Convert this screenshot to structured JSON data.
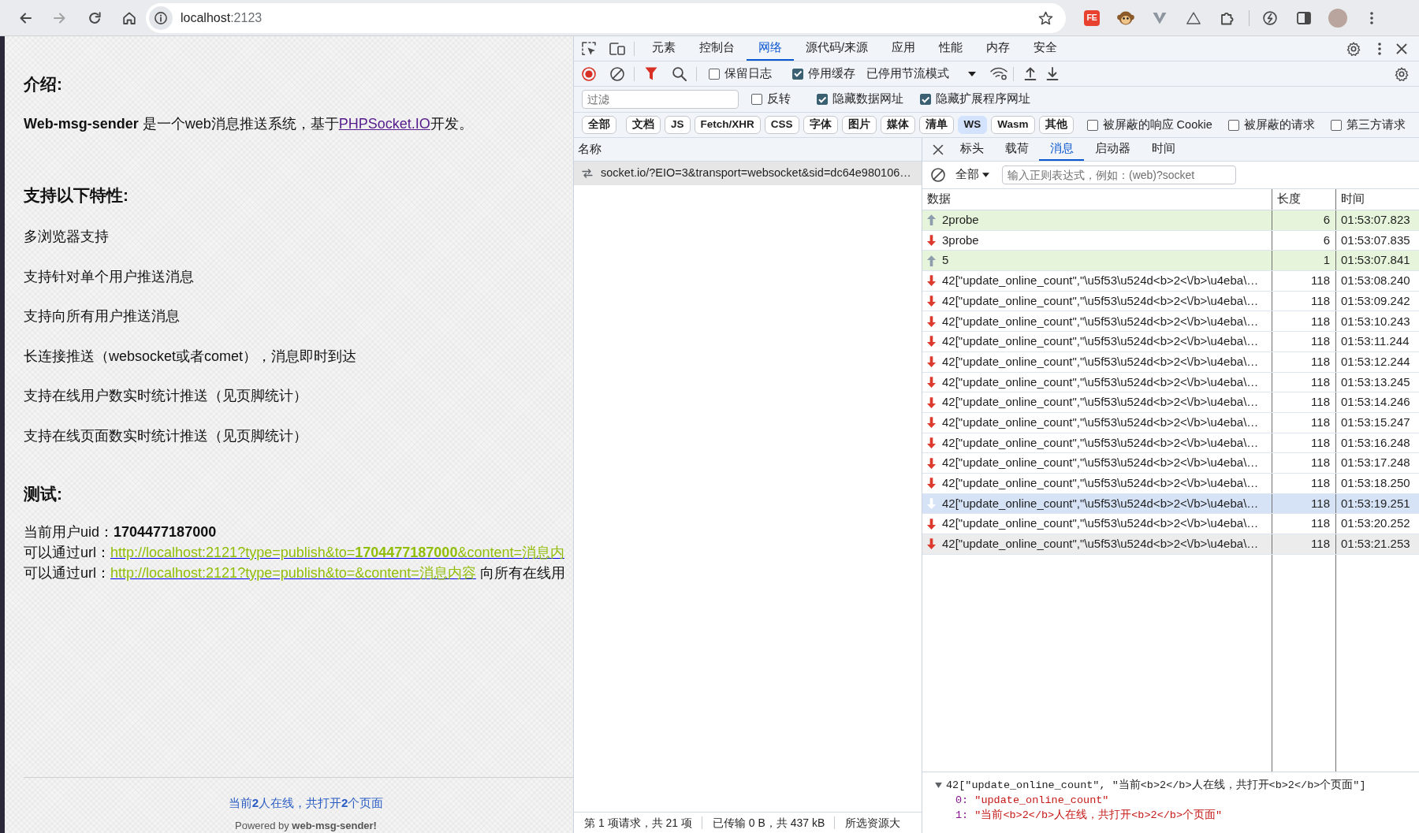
{
  "browser": {
    "host": "localhost",
    "port": ":2123",
    "extension_label": "FE"
  },
  "page": {
    "intro_heading": "介绍:",
    "intro": {
      "before": "**Web-msg-sender** 是一个web消息推送系统，基于",
      "link": "PHPSocket.IO",
      "after": "开发。"
    },
    "features_heading": "支持以下特性:",
    "features": [
      "多浏览器支持",
      "支持针对单个用户推送消息",
      "支持向所有用户推送消息",
      "长连接推送（websocket或者comet），消息即时到达",
      "支持在线用户数实时统计推送（见页脚统计）",
      "支持在线页面数实时统计推送（见页脚统计）"
    ],
    "test_heading": "测试:",
    "test_lines": [
      {
        "kind": "text",
        "text": "当前用户uid：**1704477187000**"
      },
      {
        "kind": "link",
        "before": "可以通过url：",
        "link": "http://localhost:2121?type=publish&to=**1704477187000**&content=消息内"
      },
      {
        "kind": "link",
        "before": "可以通过url：",
        "link": "http://localhost:2121?type=publish&to=&content=消息内容",
        "after": " 向所有在线用"
      }
    ],
    "footer": {
      "online": "当前**2**人在线，共打开**2**个页面",
      "powered_before": "Powered by ",
      "powered_link": "web-msg-sender!"
    }
  },
  "devtools": {
    "tabs": [
      {
        "label": "元素",
        "selected": false
      },
      {
        "label": "控制台",
        "selected": false
      },
      {
        "label": "网络",
        "selected": true
      },
      {
        "label": "源代码/来源",
        "selected": false
      },
      {
        "label": "应用",
        "selected": false
      },
      {
        "label": "性能",
        "selected": false
      },
      {
        "label": "内存",
        "selected": false
      },
      {
        "label": "安全",
        "selected": false
      }
    ],
    "toolbar": {
      "checkboxes": [
        {
          "label": "保留日志",
          "checked": false
        },
        {
          "label": "停用缓存",
          "checked": true
        }
      ],
      "throttling": "已停用节流模式"
    },
    "filter": {
      "placeholder": "过滤",
      "options": [
        {
          "label": "反转",
          "checked": false
        },
        {
          "label": "隐藏数据网址",
          "checked": true
        },
        {
          "label": "隐藏扩展程序网址",
          "checked": true
        }
      ]
    },
    "type_filters": [
      {
        "label": "全部",
        "selected": false
      },
      {
        "label": "文档",
        "selected": false
      },
      {
        "label": "JS",
        "selected": false
      },
      {
        "label": "Fetch/XHR",
        "selected": false
      },
      {
        "label": "CSS",
        "selected": false
      },
      {
        "label": "字体",
        "selected": false
      },
      {
        "label": "图片",
        "selected": false
      },
      {
        "label": "媒体",
        "selected": false
      },
      {
        "label": "清单",
        "selected": false
      },
      {
        "label": "WS",
        "selected": true
      },
      {
        "label": "Wasm",
        "selected": false
      },
      {
        "label": "其他",
        "selected": false
      }
    ],
    "type_options": [
      {
        "label": "被屏蔽的响应 Cookie",
        "checked": false
      },
      {
        "label": "被屏蔽的请求",
        "checked": false
      },
      {
        "label": "第三方请求",
        "checked": false
      }
    ],
    "requests": {
      "column": "名称",
      "rows": [
        {
          "name": "socket.io/?EIO=3&transport=websocket&sid=dc64e980106…",
          "selected": true
        }
      ]
    },
    "status_bar": [
      "第 1 项请求，共 21 项",
      "已传输 0 B，共 437 kB",
      "所选资源大"
    ],
    "detail": {
      "tabs": [
        {
          "label": "标头",
          "selected": false
        },
        {
          "label": "载荷",
          "selected": false
        },
        {
          "label": "消息",
          "selected": true
        },
        {
          "label": "启动器",
          "selected": false
        },
        {
          "label": "时间",
          "selected": false
        }
      ],
      "message_filter": {
        "type": "全部",
        "placeholder": "输入正则表达式，例如：(web)?socket"
      },
      "columns": [
        "数据",
        "长度",
        "时间"
      ],
      "messages": [
        {
          "kind": "sent",
          "data": "2probe",
          "length": "6",
          "time": "01:53:07.823",
          "selected": false,
          "hovered": false
        },
        {
          "kind": "received",
          "data": "3probe",
          "length": "6",
          "time": "01:53:07.835",
          "selected": false,
          "hovered": false
        },
        {
          "kind": "sent",
          "data": "5",
          "length": "1",
          "time": "01:53:07.841",
          "selected": false,
          "hovered": false
        },
        {
          "kind": "received",
          "data": "42[\"update_online_count\",\"\\u5f53\\u524d<b>2<\\/b>\\u4eba\\…",
          "length": "118",
          "time": "01:53:08.240",
          "selected": false,
          "hovered": false
        },
        {
          "kind": "received",
          "data": "42[\"update_online_count\",\"\\u5f53\\u524d<b>2<\\/b>\\u4eba\\…",
          "length": "118",
          "time": "01:53:09.242",
          "selected": false,
          "hovered": false
        },
        {
          "kind": "received",
          "data": "42[\"update_online_count\",\"\\u5f53\\u524d<b>2<\\/b>\\u4eba\\…",
          "length": "118",
          "time": "01:53:10.243",
          "selected": false,
          "hovered": false
        },
        {
          "kind": "received",
          "data": "42[\"update_online_count\",\"\\u5f53\\u524d<b>2<\\/b>\\u4eba\\…",
          "length": "118",
          "time": "01:53:11.244",
          "selected": false,
          "hovered": false
        },
        {
          "kind": "received",
          "data": "42[\"update_online_count\",\"\\u5f53\\u524d<b>2<\\/b>\\u4eba\\…",
          "length": "118",
          "time": "01:53:12.244",
          "selected": false,
          "hovered": false
        },
        {
          "kind": "received",
          "data": "42[\"update_online_count\",\"\\u5f53\\u524d<b>2<\\/b>\\u4eba\\…",
          "length": "118",
          "time": "01:53:13.245",
          "selected": false,
          "hovered": false
        },
        {
          "kind": "received",
          "data": "42[\"update_online_count\",\"\\u5f53\\u524d<b>2<\\/b>\\u4eba\\…",
          "length": "118",
          "time": "01:53:14.246",
          "selected": false,
          "hovered": false
        },
        {
          "kind": "received",
          "data": "42[\"update_online_count\",\"\\u5f53\\u524d<b>2<\\/b>\\u4eba\\…",
          "length": "118",
          "time": "01:53:15.247",
          "selected": false,
          "hovered": false
        },
        {
          "kind": "received",
          "data": "42[\"update_online_count\",\"\\u5f53\\u524d<b>2<\\/b>\\u4eba\\…",
          "length": "118",
          "time": "01:53:16.248",
          "selected": false,
          "hovered": false
        },
        {
          "kind": "received",
          "data": "42[\"update_online_count\",\"\\u5f53\\u524d<b>2<\\/b>\\u4eba\\…",
          "length": "118",
          "time": "01:53:17.248",
          "selected": false,
          "hovered": false
        },
        {
          "kind": "received",
          "data": "42[\"update_online_count\",\"\\u5f53\\u524d<b>2<\\/b>\\u4eba\\…",
          "length": "118",
          "time": "01:53:18.250",
          "selected": false,
          "hovered": false
        },
        {
          "kind": "received",
          "data": "42[\"update_online_count\",\"\\u5f53\\u524d<b>2<\\/b>\\u4eba\\…",
          "length": "118",
          "time": "01:53:19.251",
          "selected": true,
          "hovered": false
        },
        {
          "kind": "received",
          "data": "42[\"update_online_count\",\"\\u5f53\\u524d<b>2<\\/b>\\u4eba\\…",
          "length": "118",
          "time": "01:53:20.252",
          "selected": false,
          "hovered": false
        },
        {
          "kind": "received",
          "data": "42[\"update_online_count\",\"\\u5f53\\u524d<b>2<\\/b>\\u4eba\\…",
          "length": "118",
          "time": "01:53:21.253",
          "selected": false,
          "hovered": true
        }
      ],
      "preview": {
        "expanded": true,
        "summary": "42[\"update_online_count\", \"当前<b>2</b>人在线，共打开<b>2</b>个页面\"]",
        "entries": [
          {
            "key": "0:",
            "value": "\"update_online_count\""
          },
          {
            "key": "1:",
            "value": "\"当前<b>2</b>人在线，共打开<b>2</b>个页面\""
          }
        ]
      }
    }
  }
}
